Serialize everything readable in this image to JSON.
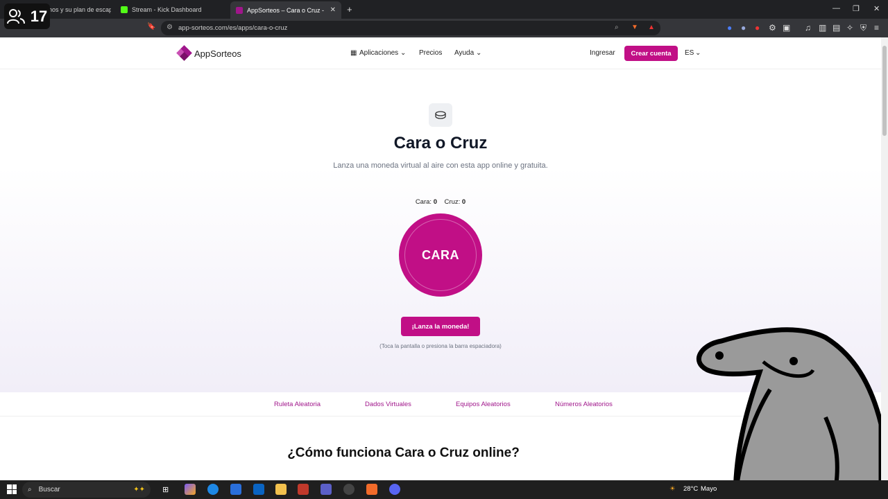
{
  "browser": {
    "tabs": [
      {
        "label": "inos y su plan de escap",
        "fav_color": "#555555"
      },
      {
        "label": "Stream - Kick Dashboard",
        "fav_color": "#53fc18"
      },
      {
        "label": "AppSorteos – Cara o Cruz - Tirar",
        "fav_color": "#a0168b"
      }
    ],
    "url": "app-sorteos.com/es/apps/cara-o-cruz"
  },
  "stream_overlay": {
    "viewers": "17"
  },
  "nav": {
    "logo_text": "AppSorteos",
    "links": [
      "Aplicaciones",
      "Precios",
      "Ayuda"
    ],
    "login": "Ingresar",
    "create": "Crear cuenta",
    "lang": "ES"
  },
  "hero": {
    "title": "Cara o Cruz",
    "subtitle": "Lanza una moneda virtual al aire con esta app online y gratuita.",
    "score_heads_label": "Cara:",
    "score_heads": "0",
    "score_tails_label": "Cruz:",
    "score_tails": "0",
    "coin_face": "CARA",
    "flip_button": "¡Lanza la moneda!",
    "hint": "(Toca la pantalla o presiona la barra espaciadora)"
  },
  "related": [
    "Ruleta Aleatoria",
    "Dados Virtuales",
    "Equipos Aleatorios",
    "Números Aleatorios"
  ],
  "howto_heading": "¿Cómo funciona Cara o Cruz online?",
  "taskbar": {
    "search": "Buscar",
    "weather": "28°C",
    "weather_text": "Mayo"
  },
  "colors": {
    "brand": "#c10f86"
  }
}
